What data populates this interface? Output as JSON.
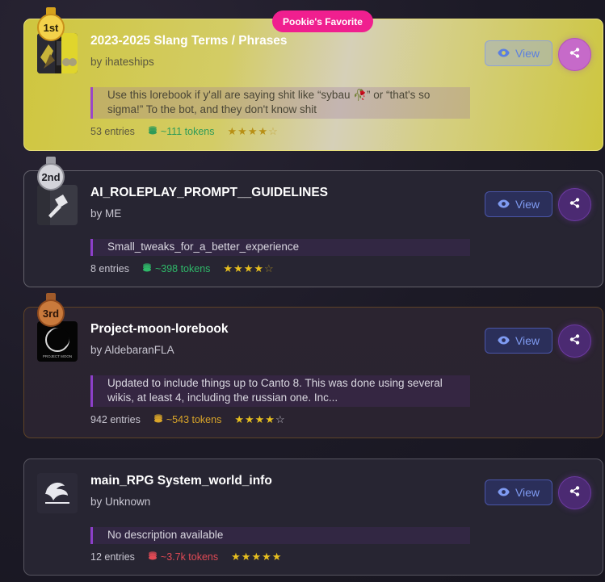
{
  "badge": "Pookie's Favorite",
  "view_label": "View",
  "cards": [
    {
      "rank": "1st",
      "title": "2023-2025 Slang Terms / Phrases",
      "author": "by ihateships",
      "description": "Use this lorebook if y'all are saying shit like “sybau 🥀” or “that's so sigma!” To the bot, and they don't know shit",
      "entries": "53 entries",
      "tokens": "~111 tokens",
      "tokens_color": "#2e9b58",
      "rating": 4.5
    },
    {
      "rank": "2nd",
      "title": "AI_ROLEPLAY_PROMPT__GUIDELINES",
      "author": "by ME",
      "description": "Small_tweaks_for_a_better_experience",
      "entries": "8 entries",
      "tokens": "~398 tokens",
      "tokens_color": "#2fb869",
      "rating": 4.5
    },
    {
      "rank": "3rd",
      "title": "Project-moon-lorebook",
      "author": "by AldebaranFLA",
      "description": "Updated to include things up to Canto 8. This was done using several wikis, at least 4, including the russian one. Inc...",
      "thumb_caption": "PROJECT MOON",
      "entries": "942 entries",
      "tokens": "~543 tokens",
      "tokens_color": "#d9a52a",
      "rating": 4
    },
    {
      "rank": "",
      "title": "main_RPG System_world_info",
      "author": "by Unknown",
      "description": "No description available",
      "entries": "12 entries",
      "tokens": "~3.7k tokens",
      "tokens_color": "#e04a55",
      "rating": 5
    }
  ],
  "colors": {
    "gold_card": "#d3cc66",
    "accent_purple": "#8c3fc9",
    "view_text": "#7f9bf2",
    "star": "#e7bf1f",
    "badge_pink": "#f01f8f"
  }
}
